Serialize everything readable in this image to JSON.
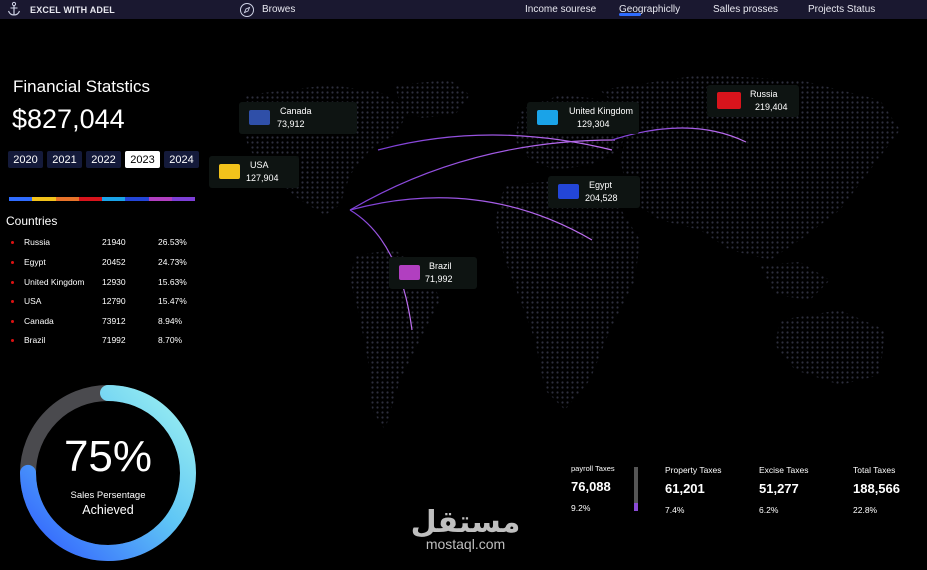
{
  "header": {
    "brand": "EXCEL WITH ADEL",
    "browse": "Browes",
    "nav": [
      {
        "label": "Income sourese"
      },
      {
        "label": "Geographiclly"
      },
      {
        "label": "Salles prosses"
      },
      {
        "label": "Projects Status"
      }
    ],
    "active_nav": "Geographiclly",
    "accent": "#2f6cff"
  },
  "summary": {
    "title": "Financial Statstics",
    "total": "$827,044"
  },
  "years": [
    "2020",
    "2021",
    "2022",
    "2023",
    "2024"
  ],
  "selected_year": "2023",
  "countries": {
    "title": "Countries",
    "rows": [
      {
        "name": "Russia",
        "value": "21940",
        "percent": "26.53%"
      },
      {
        "name": "Egypt",
        "value": "20452",
        "percent": "24.73%"
      },
      {
        "name": "United Kingdom",
        "value": "12930",
        "percent": "15.63%"
      },
      {
        "name": "USA",
        "value": "12790",
        "percent": "15.47%"
      },
      {
        "name": "Canada",
        "value": "73912",
        "percent": "8.94%"
      },
      {
        "name": "Brazil",
        "value": "71992",
        "percent": "8.70%"
      }
    ]
  },
  "gauge": {
    "percent_label": "75%",
    "value": 0.75,
    "label_line1": "Sales Persentage",
    "label_line2": "Achieved"
  },
  "map_cards": [
    {
      "name": "Canada",
      "value": "73,912",
      "color": "#2f4fa8"
    },
    {
      "name": "USA",
      "value": "127,904",
      "color": "#f2c21b"
    },
    {
      "name": "United Kingdom",
      "value": "129,304",
      "color": "#1aa3e8"
    },
    {
      "name": "Russia",
      "value": "219,404",
      "color": "#d8141c"
    },
    {
      "name": "Egypt",
      "value": "204,528",
      "color": "#2346d8"
    },
    {
      "name": "Brazil",
      "value": "71,992",
      "color": "#b13fc0"
    }
  ],
  "taxes": [
    {
      "label": "payroll Taxes",
      "value": "76,088",
      "percent": "9.2%"
    },
    {
      "label": "Property Taxes",
      "value": "61,201",
      "percent": "7.4%"
    },
    {
      "label": "Excise Taxes",
      "value": "51,277",
      "percent": "6.2%"
    },
    {
      "label": "Total Taxes",
      "value": "188,566",
      "percent": "22.8%"
    }
  ],
  "watermark": {
    "arabic": "مستقل",
    "latin": "mostaql.com"
  }
}
